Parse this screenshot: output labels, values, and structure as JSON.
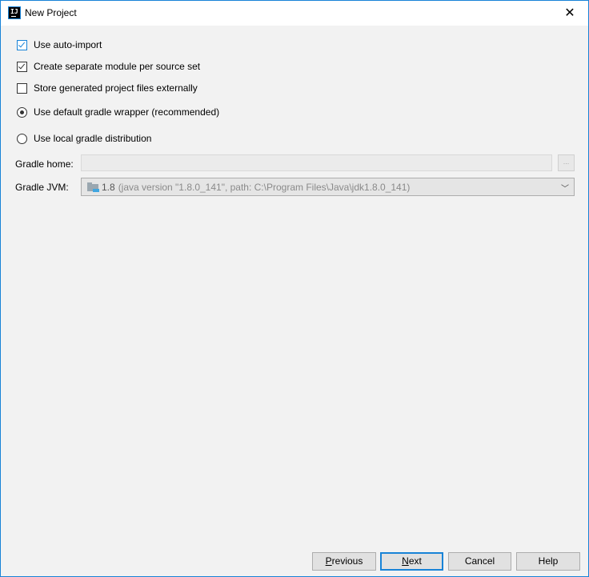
{
  "window": {
    "title": "New Project",
    "app_icon_text": "IJ"
  },
  "options": {
    "use_auto_import": {
      "label": "Use auto-import",
      "checked": true
    },
    "separate_module": {
      "label": "Create separate module per source set",
      "checked": true
    },
    "store_externally": {
      "label": "Store generated project files externally",
      "checked": false
    },
    "default_wrapper": {
      "label": "Use default gradle wrapper (recommended)",
      "selected": true
    },
    "local_distribution": {
      "label": "Use local gradle distribution",
      "selected": false
    }
  },
  "gradle_home": {
    "label": "Gradle home:",
    "value": "",
    "browse_label": "..."
  },
  "gradle_jvm": {
    "label": "Gradle JVM:",
    "version": "1.8",
    "detail": "(java version \"1.8.0_141\", path: C:\\Program Files\\Java\\jdk1.8.0_141)"
  },
  "buttons": {
    "previous": {
      "mnemonic": "P",
      "rest": "revious"
    },
    "next": {
      "mnemonic": "N",
      "rest": "ext"
    },
    "cancel": "Cancel",
    "help": "Help"
  },
  "colors": {
    "accent": "#1883d7"
  }
}
